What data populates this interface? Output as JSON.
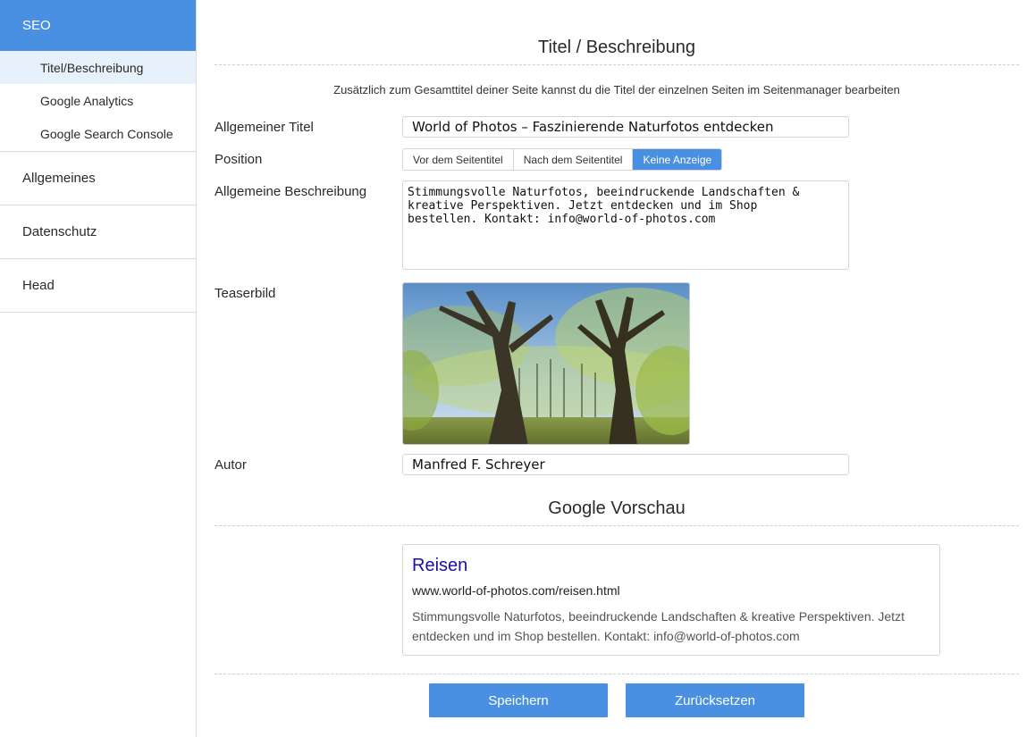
{
  "sidebar": {
    "header": "SEO",
    "sub_items": [
      {
        "label": "Titel/Beschreibung",
        "active": true
      },
      {
        "label": "Google Analytics",
        "active": false
      },
      {
        "label": "Google Search Console",
        "active": false
      }
    ],
    "sections": [
      {
        "label": "Allgemeines"
      },
      {
        "label": "Datenschutz"
      },
      {
        "label": "Head"
      }
    ]
  },
  "main": {
    "section_title": "Titel / Beschreibung",
    "hint": "Zusätzlich zum Gesamttitel deiner Seite kannst du die Titel der einzelnen Seiten im Seitenmanager bearbeiten",
    "fields": {
      "title_label": "Allgemeiner Titel",
      "title_value": "World of Photos – Faszinierende Naturfotos entdecken",
      "position_label": "Position",
      "position_options": [
        "Vor dem Seitentitel",
        "Nach dem Seitentitel",
        "Keine Anzeige"
      ],
      "position_selected": "Keine Anzeige",
      "description_label": "Allgemeine Beschreibung",
      "description_value": "Stimmungsvolle Naturfotos, beeindruckende Landschaften &\nkreative Perspektiven. Jetzt entdecken und im Shop\nbestellen. Kontakt: info@world-of-photos.com",
      "teaser_label": "Teaserbild",
      "author_label": "Autor",
      "author_value": "Manfred F. Schreyer"
    },
    "google_preview": {
      "section_title": "Google Vorschau",
      "title": "Reisen",
      "url": "www.world-of-photos.com/reisen.html",
      "description": "Stimmungsvolle Naturfotos, beeindruckende Landschaften & kreative Perspektiven. Jetzt entdecken und im Shop bestellen. Kontakt: info@world-of-photos.com"
    },
    "buttons": {
      "save": "Speichern",
      "reset": "Zurücksetzen"
    }
  },
  "colors": {
    "accent": "#4a90e2",
    "active_sub_bg": "#e6f1fc",
    "google_title": "#1a0dab"
  }
}
